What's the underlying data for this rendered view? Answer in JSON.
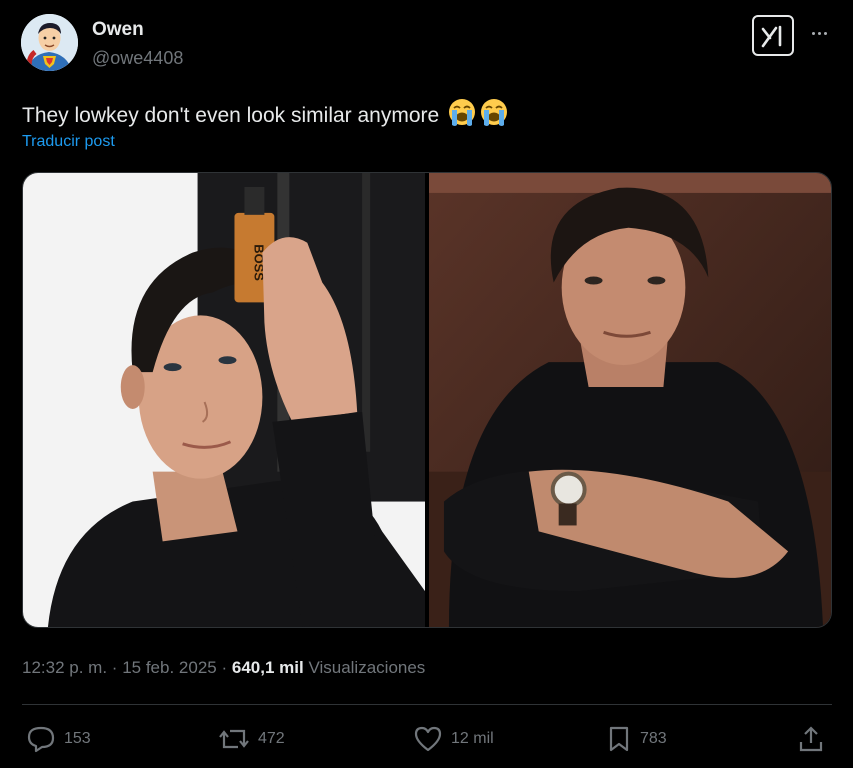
{
  "user": {
    "display_name": "Owen",
    "handle": "@owe4408",
    "avatar_icon": "superman-avatar"
  },
  "post": {
    "text": "They lowkey don't even look similar anymore",
    "emojis": [
      "loudly-crying-face-icon",
      "loudly-crying-face-icon"
    ],
    "translate_label": "Traducir post"
  },
  "media": {
    "images": [
      {
        "name": "photo-left",
        "subject": "man holding cologne bottle"
      },
      {
        "name": "photo-right",
        "subject": "man with crossed arms wearing watch"
      }
    ],
    "bottle_label": "BOSS"
  },
  "meta": {
    "time": "12:32 p. m.",
    "separator": "·",
    "date": "15 feb. 2025",
    "views_count": "640,1 mil",
    "views_label": "Visualizaciones"
  },
  "actions": {
    "replies": "153",
    "reposts": "472",
    "likes": "12 mil",
    "bookmarks": "783"
  },
  "colors": {
    "background": "#000000",
    "text": "#e7e9ea",
    "secondary": "#71767b",
    "link": "#1d9bf0",
    "divider": "#2f3336"
  }
}
